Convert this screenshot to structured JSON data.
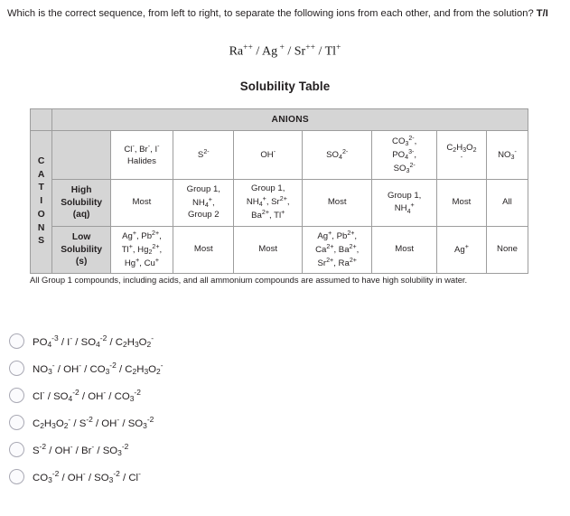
{
  "question": {
    "text_before": "Which is the correct sequence, from left to right, to separate the following ions from each other, and from the solution? ",
    "code": "T/I",
    "ion_sequence_plain": "Ra++ / Ag+ / Sr++ / Tl+"
  },
  "table": {
    "title": "Solubility Table",
    "anions_header": "ANIONS",
    "cations_header": "CATIONS",
    "column_headers": [
      "Cl-, Br-, I- Halides",
      "S2-",
      "OH-",
      "SO42-",
      "CO32-, PO43-, SO32-",
      "C2H3O2-",
      "NO3-"
    ],
    "rows": [
      {
        "label": "High Solubility (aq)",
        "cells": [
          "Most",
          "Group 1, NH4+, Group 2",
          "Group 1, NH4+, Sr2+, Ba2+, Tl+",
          "Most",
          "Group 1, NH4+",
          "Most",
          "All"
        ]
      },
      {
        "label": "Low Solubility (s)",
        "cells": [
          "Ag+, Pb2+, Tl+, Hg22+, Hg+, Cu+",
          "Most",
          "Most",
          "Ag+, Pb2+, Ca2+, Ba2+, Sr2+, Ra2+",
          "Most",
          "Ag+",
          "None"
        ]
      }
    ],
    "footnote": "All Group 1 compounds, including acids, and all ammonium compounds are assumed to have high solubility in water."
  },
  "options": [
    {
      "id": "option-a",
      "text_plain": "PO4-3 / I- / SO4-2 / C2H3O2-",
      "selected": false
    },
    {
      "id": "option-b",
      "text_plain": "NO3- / OH- / CO3-2 / C2H3O2-",
      "selected": false
    },
    {
      "id": "option-c",
      "text_plain": "Cl- / SO4-2 / OH- / CO3-2",
      "selected": false
    },
    {
      "id": "option-d",
      "text_plain": "C2H3O2- / S-2 / OH- / SO3-2",
      "selected": false
    },
    {
      "id": "option-e",
      "text_plain": "S-2 / OH- / Br- / SO3-2",
      "selected": false
    },
    {
      "id": "option-f",
      "text_plain": "CO3-2 / OH- / SO3-2 / Cl-",
      "selected": false
    }
  ],
  "colors": {
    "text": "#231f20",
    "table_border": "#9d9d9d",
    "table_shaded": "#d5d5d5",
    "radio_border": "#a9a9b4"
  }
}
